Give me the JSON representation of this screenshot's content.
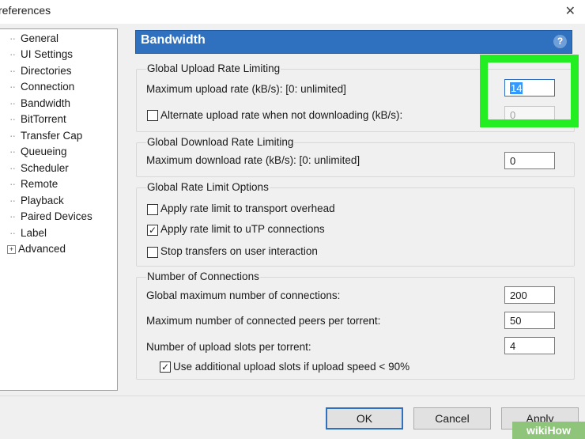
{
  "window": {
    "title": "references",
    "close_glyph": "✕"
  },
  "tree": {
    "items": [
      {
        "label": "General"
      },
      {
        "label": "UI Settings"
      },
      {
        "label": "Directories"
      },
      {
        "label": "Connection"
      },
      {
        "label": "Bandwidth",
        "selected": true
      },
      {
        "label": "BitTorrent"
      },
      {
        "label": "Transfer Cap"
      },
      {
        "label": "Queueing"
      },
      {
        "label": "Scheduler"
      },
      {
        "label": "Remote"
      },
      {
        "label": "Playback"
      },
      {
        "label": "Paired Devices"
      },
      {
        "label": "Label"
      },
      {
        "label": "Advanced",
        "expandable": true
      }
    ],
    "expander_glyph": "+"
  },
  "panel": {
    "title": "Bandwidth",
    "help_icon": "question-mark-icon",
    "help_glyph": "?"
  },
  "upload": {
    "title": "Global Upload Rate Limiting",
    "max_label": "Maximum upload rate (kB/s): [0: unlimited]",
    "max_value": "14",
    "alt_label": "Alternate upload rate when not downloading (kB/s):",
    "alt_value": "0",
    "alt_checked": false
  },
  "download": {
    "title": "Global Download Rate Limiting",
    "max_label": "Maximum download rate (kB/s): [0: unlimited]",
    "max_value": "0"
  },
  "options": {
    "title": "Global Rate Limit Options",
    "transport_label": "Apply rate limit to transport overhead",
    "transport_checked": false,
    "utp_label": "Apply rate limit to uTP connections",
    "utp_checked": true,
    "stop_label": "Stop transfers on user interaction",
    "stop_checked": false
  },
  "connections": {
    "title": "Number of Connections",
    "global_label": "Global maximum number of connections:",
    "global_value": "200",
    "peers_label": "Maximum number of connected peers per torrent:",
    "peers_value": "50",
    "slots_label": "Number of upload slots per torrent:",
    "slots_value": "4",
    "additional_label": "Use additional upload slots if upload speed < 90%",
    "additional_checked": true
  },
  "buttons": {
    "ok": "OK",
    "cancel": "Cancel",
    "apply": "Apply"
  },
  "check_glyph": "✓",
  "watermark": "wikiHow",
  "colors": {
    "header_blue": "#2f70bf",
    "highlight_green": "#22ee22"
  }
}
